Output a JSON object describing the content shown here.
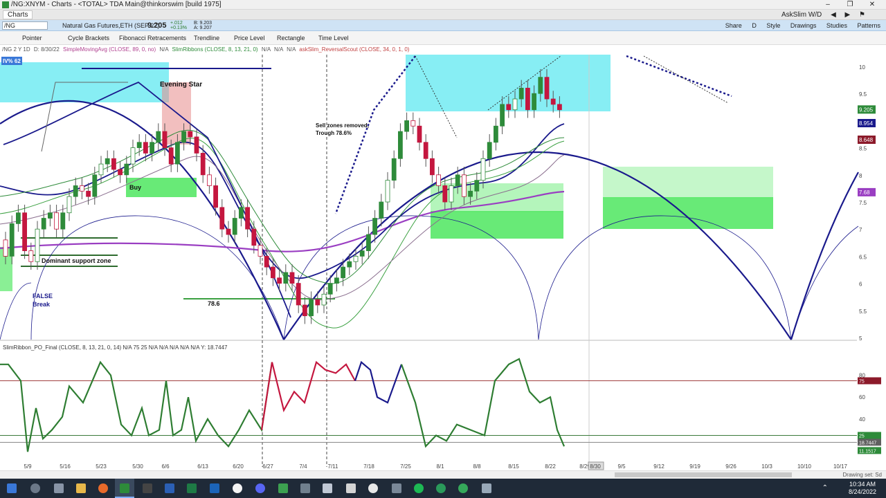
{
  "window": {
    "title": "/NG:XNYM - Charts - <TOTAL> TDA Main@thinkorswim [build 1975]",
    "controls": [
      "–",
      "❐",
      "✕"
    ]
  },
  "tabbar": {
    "tab": "Charts",
    "user": "AskSlim W/D"
  },
  "symbolbar": {
    "symbol": "/NG",
    "description": "Natural Gas Futures,ETH (SEP 22)",
    "last": "9.205",
    "change": "+.012",
    "change_pct": "+0.13%",
    "bid": "B: 9.203",
    "ask": "A: 9.207",
    "tools": [
      "Share",
      "D",
      "Style",
      "Drawings",
      "Studies",
      "Patterns"
    ]
  },
  "drawbar": {
    "items": [
      "Pointer",
      "Cycle Brackets",
      "Fibonacci Retracements",
      "Trendline",
      "Price Level",
      "Rectangle",
      "Time Level"
    ]
  },
  "studybar": {
    "chart_spec": "/NG 2 Y 1D",
    "date": "D: 8/30/22",
    "sma": "SimpleMovingAvg (CLOSE, 89, 0, no)",
    "sma_val": "N/A",
    "ribbons": "SlimRibbons (CLOSE, 8, 13, 21, 0)",
    "rib_vals": [
      "N/A",
      "N/A",
      "N/A"
    ],
    "rev": "askSlim_ReversalScout (CLOSE, 34, 0, 1, 0)"
  },
  "upper": {
    "ivp": "IV% 62",
    "y_ticks": [
      "10",
      "9.5",
      "9",
      "8.5",
      "8",
      "7.5",
      "7",
      "6.5",
      "6",
      "5.5",
      "5"
    ],
    "badges": [
      {
        "label": "9.205",
        "color": "#2e8b3a"
      },
      {
        "label": "8.954",
        "color": "#1a1a8c"
      },
      {
        "label": "8.648",
        "color": "#8c1a2a"
      },
      {
        "label": "7.68",
        "color": "#9a3ec2"
      }
    ],
    "annotations": {
      "evening_star": "Evening Star",
      "buy": "Buy",
      "support": "Dominant support zone",
      "false_break": [
        "FALSE",
        "Break"
      ],
      "fib": "78.6",
      "sell_removed": [
        "Sell zones removed,",
        "Trough 78.6%"
      ]
    }
  },
  "lower": {
    "study_label": "SlimRibbon_PO_Final (CLOSE, 8, 13, 21, 0, 14)",
    "values": [
      "N/A",
      "75",
      "25",
      "N/A",
      "N/A",
      "N/A",
      "N/A",
      "N/A"
    ],
    "y_value": "Y: 18.7447",
    "y_ticks": [
      "80",
      "60",
      "40",
      "20"
    ],
    "badges": [
      {
        "label": "75",
        "color": "#8c1a2a"
      },
      {
        "label": "25",
        "color": "#2e8b3a"
      },
      {
        "label": "18.7447",
        "color": "#606060"
      },
      {
        "label": "11.1517",
        "color": "#2e8b3a"
      }
    ]
  },
  "x_axis": {
    "labels": [
      "5/9",
      "5/16",
      "5/23",
      "5/30",
      "6/6",
      "6/13",
      "6/20",
      "6/27",
      "7/4",
      "7/11",
      "7/18",
      "7/25",
      "8/1",
      "8/8",
      "8/15",
      "8/22",
      "8/29",
      "8/30",
      "9/5",
      "9/12",
      "9/19",
      "9/26",
      "10/3",
      "10/10",
      "10/17"
    ]
  },
  "statusbar": {
    "drawing_set": "Drawing set: Sd"
  },
  "taskbar": {
    "time": "10:34 AM",
    "date": "8/24/2022"
  },
  "colors": {
    "candle_up": "#2e8b3a",
    "candle_down": "#c4173f",
    "cycle": "#1a1a8c",
    "sma": "#9a3ec2",
    "zone_cyan": "#5fe8f0",
    "zone_green": "#58e868",
    "osc_green": "#2e7d32",
    "osc_red": "#c4173f",
    "osc_blue": "#1a1a8c"
  }
}
